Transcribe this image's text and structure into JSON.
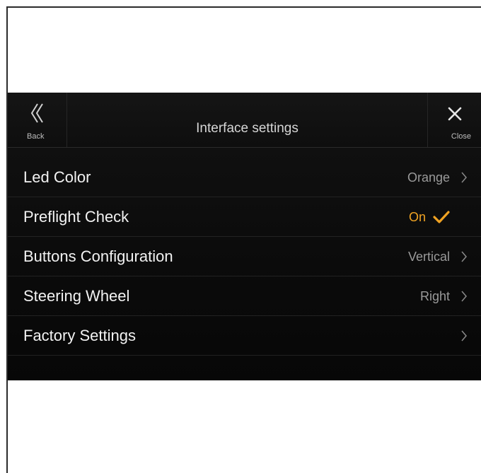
{
  "header": {
    "back_label": "Back",
    "title": "Interface settings",
    "close_label": "Close"
  },
  "settings": [
    {
      "label": "Led Color",
      "value": "Orange",
      "control": "chevron"
    },
    {
      "label": "Preflight Check",
      "value": "On",
      "control": "checkmark"
    },
    {
      "label": "Buttons Configuration",
      "value": "Vertical",
      "control": "chevron"
    },
    {
      "label": "Steering Wheel",
      "value": "Right",
      "control": "chevron"
    },
    {
      "label": "Factory Settings",
      "value": "",
      "control": "chevron"
    }
  ],
  "icons": {
    "back": "double-chevron-left-icon",
    "close": "close-icon",
    "chevron": "chevron-right-icon",
    "check": "checkmark-icon"
  },
  "colors": {
    "accent": "#f0a323",
    "background": "#0d0d0d",
    "text": "#f2f2f2",
    "muted": "#9a9a9a"
  }
}
